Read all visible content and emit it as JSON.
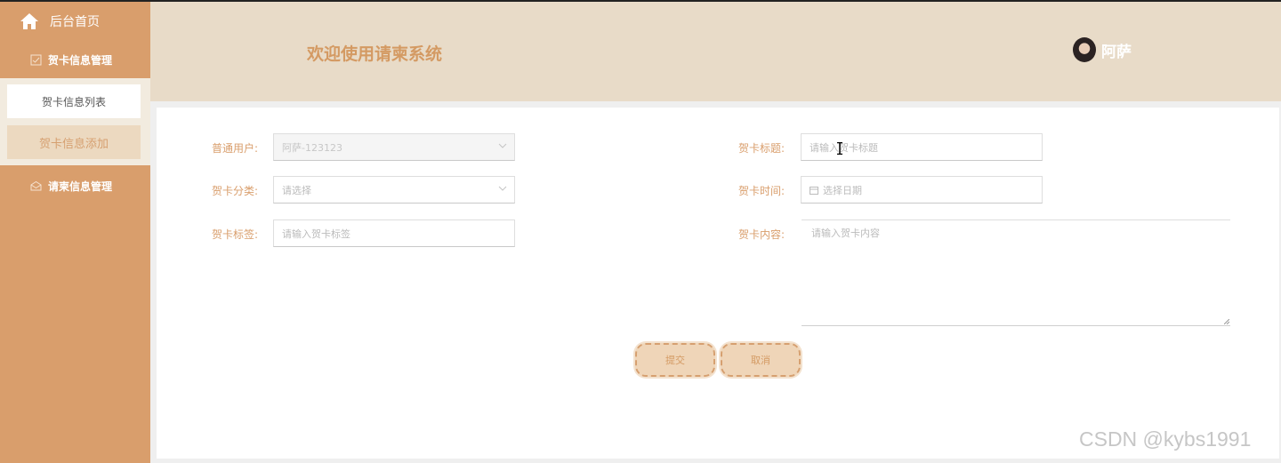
{
  "sidebar": {
    "home_label": "后台首页",
    "group1_label": "贺卡信息管理",
    "sub_items": [
      {
        "label": "贺卡信息列表"
      },
      {
        "label": "贺卡信息添加"
      }
    ],
    "group2_label": "请柬信息管理"
  },
  "header": {
    "welcome": "欢迎使用请柬系统",
    "username": "阿萨"
  },
  "form": {
    "user_label": "普通用户:",
    "user_value": "阿萨-123123",
    "category_label": "贺卡分类:",
    "category_placeholder": "请选择",
    "tag_label": "贺卡标签:",
    "tag_placeholder": "请输入贺卡标签",
    "title_label": "贺卡标题:",
    "title_placeholder": "请输入贺卡标题",
    "time_label": "贺卡时间:",
    "time_placeholder": "选择日期",
    "content_label": "贺卡内容:",
    "content_placeholder": "请输入贺卡内容",
    "submit_label": "提交",
    "cancel_label": "取消"
  },
  "watermark": "CSDN @kybs1991",
  "colors": {
    "sidebar": "#d99e6c",
    "header": "#e8dbc8",
    "accent": "#d49a63",
    "button": "#efd5b8"
  },
  "icons": {
    "home": "home-icon",
    "group1": "checkbox-icon",
    "group2": "envelope-icon",
    "calendar": "calendar-icon",
    "select_arrow": "chevron-down-icon"
  }
}
